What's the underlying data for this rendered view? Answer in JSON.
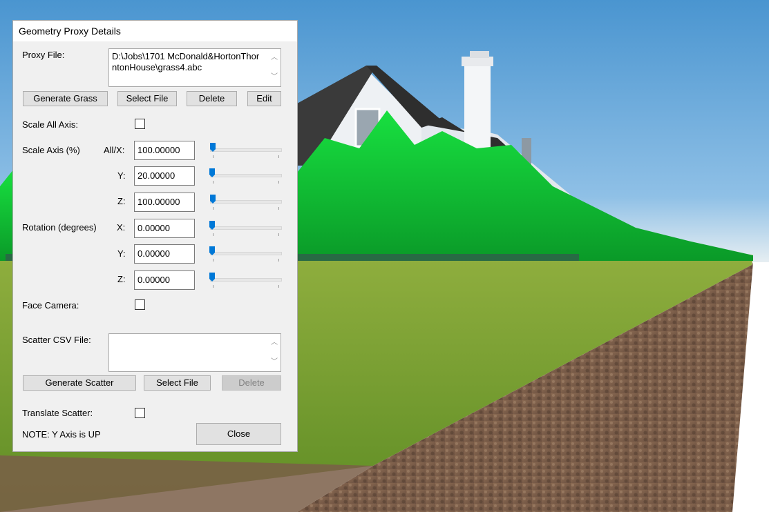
{
  "dialog": {
    "title": "Geometry Proxy Details",
    "proxy_file_label": "Proxy File:",
    "proxy_file_value": "D:\\Jobs\\1701 McDonald&HortonThorntonHouse\\grass4.abc",
    "generate_grass_label": "Generate Grass",
    "select_file_label": "Select File",
    "delete_label": "Delete",
    "edit_label": "Edit",
    "scale_all_axis_label": "Scale All Axis:",
    "scale_all_axis_checked": false,
    "scale_axis_label": "Scale Axis (%)",
    "rotation_label": "Rotation (degrees)",
    "axis_labels": {
      "all_x": "All/X:",
      "y": "Y:",
      "z": "Z:",
      "x": "X:"
    },
    "scale": {
      "x": "100.00000",
      "y": "20.00000",
      "z": "100.00000"
    },
    "rotation": {
      "x": "0.00000",
      "y": "0.00000",
      "z": "0.00000"
    },
    "face_camera_label": "Face Camera:",
    "face_camera_checked": false,
    "scatter_csv_label": "Scatter CSV File:",
    "scatter_csv_value": "",
    "generate_scatter_label": "Generate Scatter",
    "scatter_select_file_label": "Select File",
    "scatter_delete_label": "Delete",
    "translate_scatter_label": "Translate Scatter:",
    "translate_scatter_checked": false,
    "note": "NOTE: Y Axis is UP",
    "close_label": "Close"
  },
  "colors": {
    "sky_top": "#4c97d2",
    "sky_bottom": "#cfe2f3",
    "grass_green": "#00d030",
    "lawn": "#6f9a2a",
    "soil": "#7a5a44",
    "slider_thumb": "#0078d7"
  }
}
